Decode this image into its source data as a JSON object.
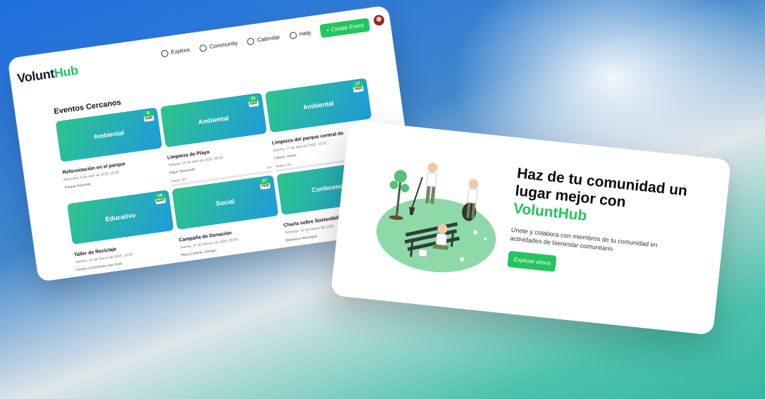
{
  "nav": {
    "logo_main": "Volunt",
    "logo_accent": "Hub",
    "links": [
      {
        "label": "Explore",
        "icon": "compass-icon"
      },
      {
        "label": "Community",
        "icon": "users-icon"
      },
      {
        "label": "Calendar",
        "icon": "calendar-icon"
      },
      {
        "label": "Help",
        "icon": "help-icon"
      }
    ],
    "create_label": "+ Create Event"
  },
  "section_title": "Eventos Cercanos",
  "events": [
    {
      "category": "Ambiental",
      "day": "9",
      "month": "ABR",
      "title": "Reforestación en el parque",
      "meta": "Miércoles, 9 de abril de 2025, 10:30",
      "location": "Parque Nacional",
      "spots": "",
      "progress": ""
    },
    {
      "category": "Ambiental",
      "day": "19",
      "month": "ABR",
      "title": "Limpieza de Playa",
      "meta": "Sábado, 19 de abril de 2025, 09:00",
      "location": "Playa Tamarindo",
      "spots": "Tareas: 0/5",
      "progress": "0%"
    },
    {
      "category": "Ambiental",
      "day": "17",
      "month": "ABR",
      "title": "Limpieza del parque central de",
      "meta": "Jueves, 17 de abril de 2025, 13:51",
      "location": "Liberia, centro",
      "spots": "Tareas: 0/4",
      "progress": ""
    },
    {
      "category": "Educativo",
      "day": "14",
      "month": "MAR",
      "title": "Taller de Reciclaje",
      "meta": "Viernes, 14 de marzo de 2025, 15:00",
      "location": "Centro Comunitario San José",
      "spots": "",
      "progress": ""
    },
    {
      "category": "Social",
      "day": "27",
      "month": "FEB",
      "title": "Campaña de Donación",
      "meta": "Jueves, 27 de febrero de 2025, 09:00",
      "location": "Plaza Central, Cartago",
      "spots": "",
      "progress": ""
    },
    {
      "category": "Conferencia",
      "day": "",
      "month": "",
      "title": "Charla sobre Sostenibilidad",
      "meta": "Domingo, 16 de marzo de 2025",
      "location": "Biblioteca Municipal",
      "spots": "",
      "progress": ""
    }
  ],
  "hero": {
    "title": "Haz de tu comunidad un lugar mejor con",
    "brand": "VoluntHub",
    "subtitle": "Unete y colabora con miembros de tu comunidad en actividades de bienestar comunitario",
    "cta": "Explorar ahora"
  },
  "colors": {
    "accent": "#22c55e",
    "gradient_start": "#2ec48a",
    "gradient_end": "#1f9bdc"
  }
}
